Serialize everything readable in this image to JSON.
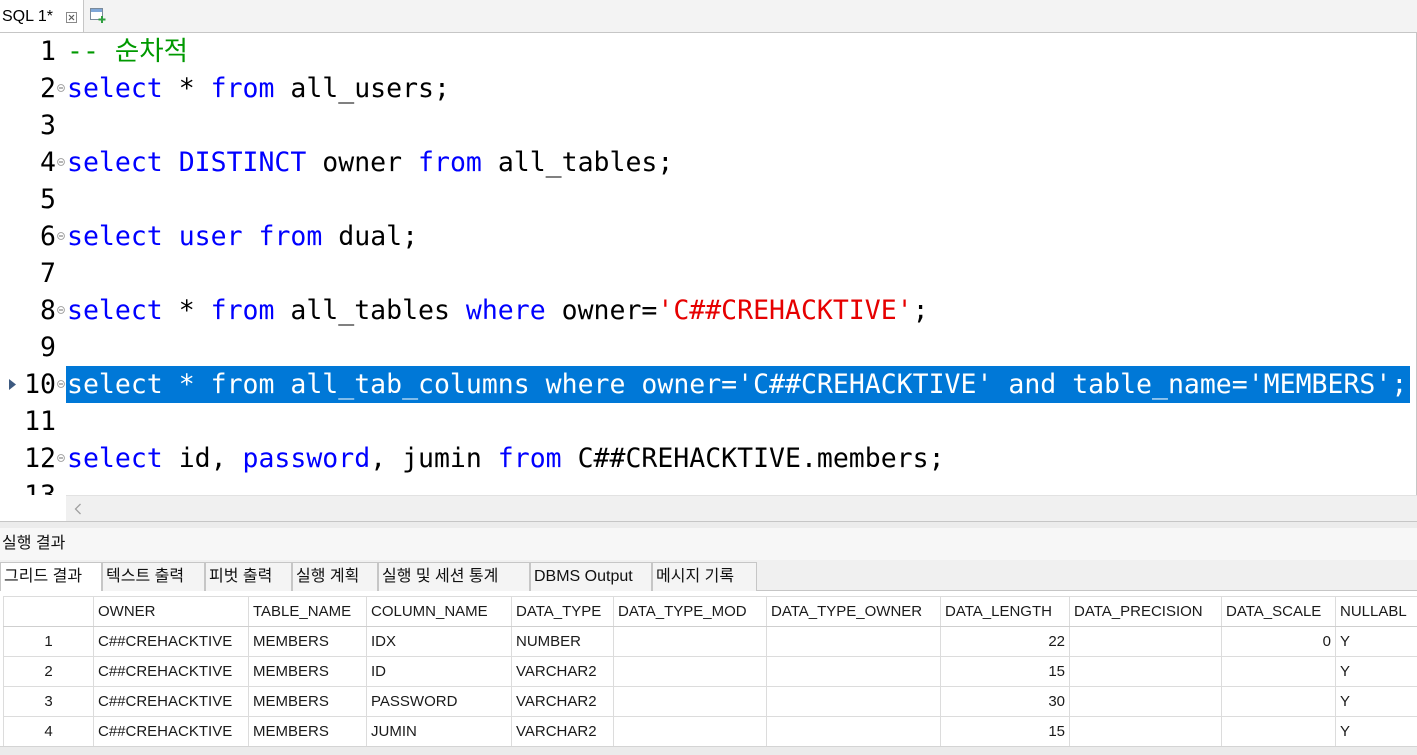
{
  "editor_tabs": [
    {
      "label": "SQL 1*",
      "close_icon": "close-icon"
    }
  ],
  "new_editor_icon": "new-sql-editor-icon",
  "editor": {
    "selected_line": 10,
    "current_line_icon": "arrow-right-icon",
    "fold_icon": "fold-minus-icon",
    "scroll_left_icon": "chevron-left-icon",
    "lines": [
      {
        "number": "1",
        "fold": false,
        "tokens": [
          {
            "text": "-- 순차적",
            "color": "#009900"
          }
        ]
      },
      {
        "number": "2",
        "fold": true,
        "tokens": [
          {
            "text": "select",
            "color": "#0000ff"
          },
          {
            "text": " * ",
            "color": "#000000"
          },
          {
            "text": "from",
            "color": "#0000ff"
          },
          {
            "text": " all_users;",
            "color": "#000000"
          }
        ]
      },
      {
        "number": "3",
        "fold": false,
        "tokens": []
      },
      {
        "number": "4",
        "fold": true,
        "tokens": [
          {
            "text": "select",
            "color": "#0000ff"
          },
          {
            "text": " ",
            "color": "#000000"
          },
          {
            "text": "DISTINCT",
            "color": "#0000ff"
          },
          {
            "text": " owner ",
            "color": "#000000"
          },
          {
            "text": "from",
            "color": "#0000ff"
          },
          {
            "text": " all_tables;",
            "color": "#000000"
          }
        ]
      },
      {
        "number": "5",
        "fold": false,
        "tokens": []
      },
      {
        "number": "6",
        "fold": true,
        "tokens": [
          {
            "text": "select",
            "color": "#0000ff"
          },
          {
            "text": " ",
            "color": "#000000"
          },
          {
            "text": "user",
            "color": "#0000ff"
          },
          {
            "text": " ",
            "color": "#000000"
          },
          {
            "text": "from",
            "color": "#0000ff"
          },
          {
            "text": " dual;",
            "color": "#000000"
          }
        ]
      },
      {
        "number": "7",
        "fold": false,
        "tokens": []
      },
      {
        "number": "8",
        "fold": true,
        "tokens": [
          {
            "text": "select",
            "color": "#0000ff"
          },
          {
            "text": " * ",
            "color": "#000000"
          },
          {
            "text": "from",
            "color": "#0000ff"
          },
          {
            "text": " all_tables ",
            "color": "#000000"
          },
          {
            "text": "where",
            "color": "#0000ff"
          },
          {
            "text": " owner=",
            "color": "#000000"
          },
          {
            "text": "'C##CREHACKTIVE'",
            "color": "#e60000"
          },
          {
            "text": ";",
            "color": "#000000"
          }
        ]
      },
      {
        "number": "9",
        "fold": false,
        "tokens": []
      },
      {
        "number": "10",
        "fold": true,
        "tokens": [
          {
            "text": "select",
            "color": "#0000ff"
          },
          {
            "text": " * ",
            "color": "#000000"
          },
          {
            "text": "from",
            "color": "#0000ff"
          },
          {
            "text": " all_tab_columns ",
            "color": "#000000"
          },
          {
            "text": "where",
            "color": "#0000ff"
          },
          {
            "text": " owner=",
            "color": "#000000"
          },
          {
            "text": "'C##CREHACKTIVE'",
            "color": "#e60000"
          },
          {
            "text": " ",
            "color": "#000000"
          },
          {
            "text": "and",
            "color": "#0000ff"
          },
          {
            "text": " table_name=",
            "color": "#000000"
          },
          {
            "text": "'MEMBERS'",
            "color": "#e60000"
          },
          {
            "text": ";",
            "color": "#000000"
          }
        ]
      },
      {
        "number": "11",
        "fold": false,
        "tokens": []
      },
      {
        "number": "12",
        "fold": true,
        "tokens": [
          {
            "text": "select",
            "color": "#0000ff"
          },
          {
            "text": " id, ",
            "color": "#000000"
          },
          {
            "text": "password",
            "color": "#0000ff"
          },
          {
            "text": ", jumin ",
            "color": "#000000"
          },
          {
            "text": "from",
            "color": "#0000ff"
          },
          {
            "text": " C##CREHACKTIVE.members;",
            "color": "#000000"
          }
        ]
      },
      {
        "number": "13",
        "fold": false,
        "tokens": []
      }
    ]
  },
  "results": {
    "title": "실행 결과",
    "tabs": [
      {
        "label": "그리드 결과",
        "selected": true
      },
      {
        "label": "텍스트 출력",
        "selected": false
      },
      {
        "label": "피벗 출력",
        "selected": false
      },
      {
        "label": "실행 계획",
        "selected": false
      },
      {
        "label": "실행 및 세션 통계",
        "selected": false
      },
      {
        "label": "DBMS Output",
        "selected": false
      },
      {
        "label": "메시지 기록",
        "selected": false
      }
    ],
    "grid": {
      "columns": [
        "OWNER",
        "TABLE_NAME",
        "COLUMN_NAME",
        "DATA_TYPE",
        "DATA_TYPE_MOD",
        "DATA_TYPE_OWNER",
        "DATA_LENGTH",
        "DATA_PRECISION",
        "DATA_SCALE",
        "NULLABL"
      ],
      "rows": [
        {
          "num": "1",
          "cells": [
            "C##CREHACKTIVE",
            "MEMBERS",
            "IDX",
            "NUMBER",
            "",
            "",
            "22",
            "",
            "0",
            "Y"
          ]
        },
        {
          "num": "2",
          "cells": [
            "C##CREHACKTIVE",
            "MEMBERS",
            "ID",
            "VARCHAR2",
            "",
            "",
            "15",
            "",
            "",
            "Y"
          ]
        },
        {
          "num": "3",
          "cells": [
            "C##CREHACKTIVE",
            "MEMBERS",
            "PASSWORD",
            "VARCHAR2",
            "",
            "",
            "30",
            "",
            "",
            "Y"
          ]
        },
        {
          "num": "4",
          "cells": [
            "C##CREHACKTIVE",
            "MEMBERS",
            "JUMIN",
            "VARCHAR2",
            "",
            "",
            "15",
            "",
            "",
            "Y"
          ]
        }
      ]
    }
  },
  "colors": {
    "selection": "#0078d7",
    "selection_text": "#ffffff"
  }
}
